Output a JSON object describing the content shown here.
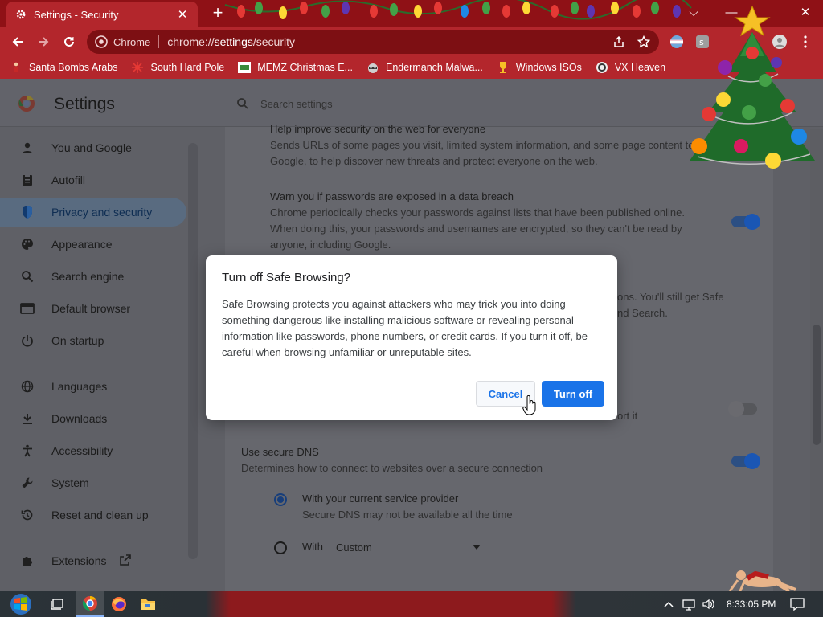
{
  "browser": {
    "tab_title": "Settings - Security",
    "tab_close": "✕",
    "new_tab": "+",
    "window_controls": {
      "dropdown": "⌵",
      "minimize": "—",
      "close": "✕"
    },
    "omnibox": {
      "site_label": "Chrome",
      "url_host": "chrome://",
      "url_bold": "settings",
      "url_path": "/security"
    }
  },
  "bookmarks": [
    {
      "label": "Santa Bombs Arabs",
      "icon": "figure-icon"
    },
    {
      "label": "South Hard Pole",
      "icon": "star-burst-icon"
    },
    {
      "label": "MEMZ Christmas E...",
      "icon": "memz-icon"
    },
    {
      "label": "Endermanch Malwa...",
      "icon": "raccoon-icon"
    },
    {
      "label": "Windows ISOs",
      "icon": "trophy-icon"
    },
    {
      "label": "VX Heaven",
      "icon": "vx-icon"
    }
  ],
  "settings": {
    "title": "Settings",
    "search_placeholder": "Search settings",
    "nav": [
      {
        "label": "You and Google",
        "icon": "person-icon",
        "active": false
      },
      {
        "label": "Autofill",
        "icon": "clipboard-icon",
        "active": false
      },
      {
        "label": "Privacy and security",
        "icon": "shield-icon",
        "active": true
      },
      {
        "label": "Appearance",
        "icon": "palette-icon",
        "active": false
      },
      {
        "label": "Search engine",
        "icon": "search-icon",
        "active": false
      },
      {
        "label": "Default browser",
        "icon": "browser-icon",
        "active": false
      },
      {
        "label": "On startup",
        "icon": "power-icon",
        "active": false
      },
      {
        "label": "Languages",
        "icon": "globe-icon",
        "active": false
      },
      {
        "label": "Downloads",
        "icon": "download-icon",
        "active": false
      },
      {
        "label": "Accessibility",
        "icon": "accessibility-icon",
        "active": false
      },
      {
        "label": "System",
        "icon": "wrench-icon",
        "active": false
      },
      {
        "label": "Reset and clean up",
        "icon": "history-icon",
        "active": false
      },
      {
        "label": "Extensions",
        "icon": "puzzle-icon",
        "active": false
      }
    ],
    "content": {
      "improve_title": "Help improve security on the web for everyone",
      "improve_line1": "Sends URLs of some pages you visit, limited system information, and some page content to",
      "improve_line2": "Google, to help discover new threats and protect everyone on the web.",
      "pw_title": "Warn you if passwords are exposed in a data breach",
      "pw_line1": "Chrome periodically checks your passwords against lists that have been published online.",
      "pw_line2": "When doing this, your passwords and usernames are encrypted, so they can't be read by",
      "pw_line3": "anyone, including Google.",
      "peek_line1": "ons. You'll still get Safe",
      "peek_line2": "nd Search.",
      "peek_line3": "ort it",
      "dns_title": "Use secure DNS",
      "dns_desc": "Determines how to connect to websites over a secure connection",
      "dns_opt1": "With your current service provider",
      "dns_opt1_sub": "Secure DNS may not be available all the time",
      "dns_opt2": "With",
      "dns_select": "Custom"
    }
  },
  "dialog": {
    "title": "Turn off Safe Browsing?",
    "body": "Safe Browsing protects you against attackers who may trick you into doing something dangerous like installing malicious software or revealing personal information like passwords, phone numbers, or credit cards. If you turn it off, be careful when browsing unfamiliar or unreputable sites.",
    "cancel": "Cancel",
    "confirm": "Turn off"
  },
  "taskbar": {
    "clock": "8:33:05 PM"
  },
  "colors": {
    "accent": "#1a73e8",
    "browser_frame": "#b3262c",
    "titlebar": "#8f1116"
  }
}
